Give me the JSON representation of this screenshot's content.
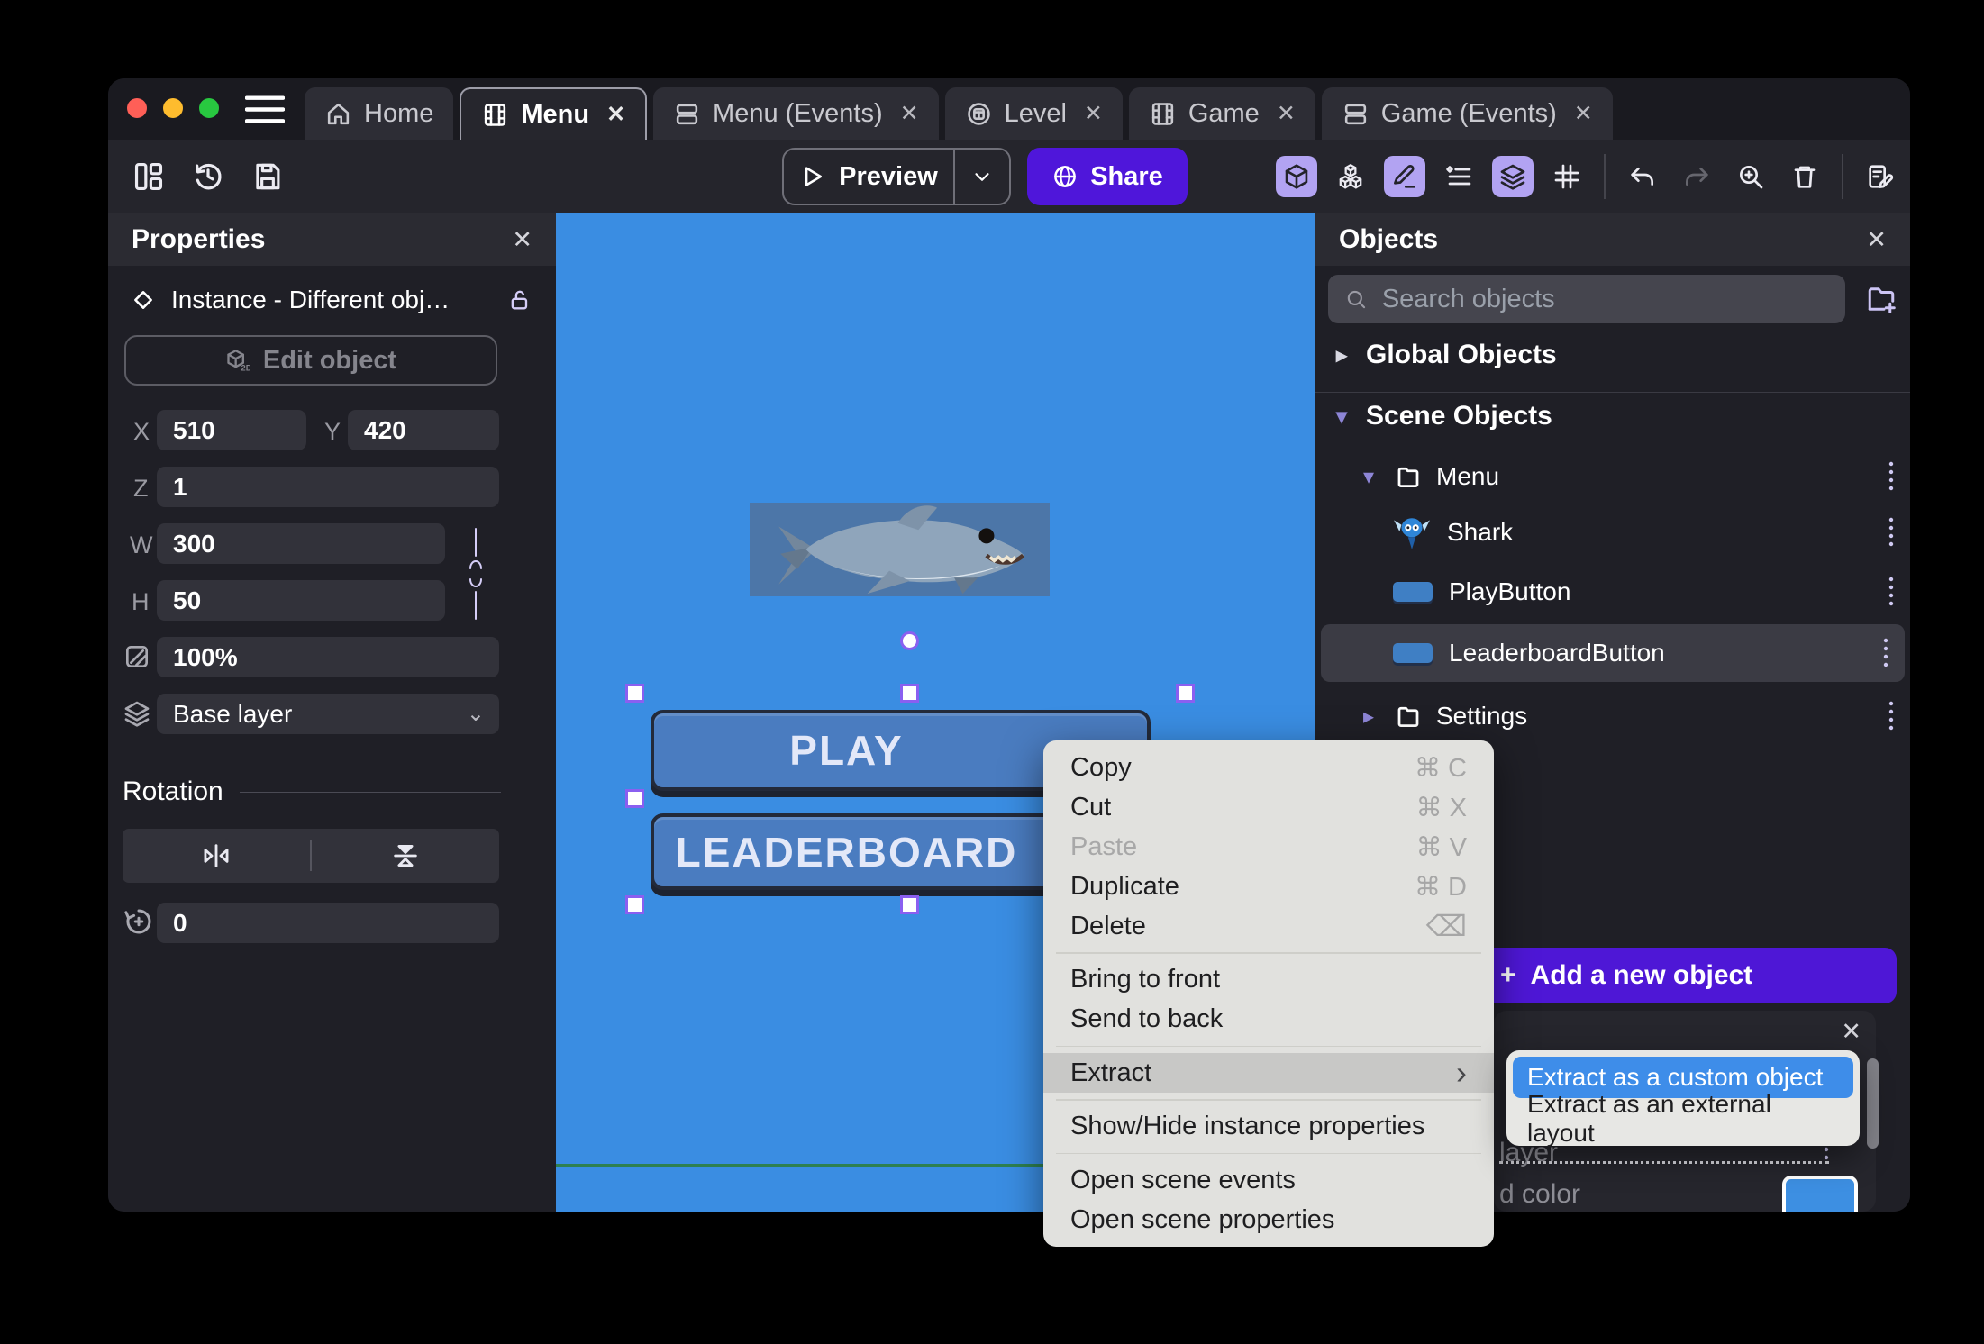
{
  "titlebar": {
    "close_glyph": "✕",
    "traffic_lights": {
      "close": "#ff5f57",
      "minimize": "#febc2e",
      "zoom": "#28c840"
    },
    "tabs": [
      {
        "label": "Home",
        "icon": "home",
        "active": false
      },
      {
        "label": "Menu",
        "icon": "film",
        "active": true
      },
      {
        "label": "Menu (Events)",
        "icon": "events",
        "active": false
      },
      {
        "label": "Level",
        "icon": "level",
        "active": false
      },
      {
        "label": "Game",
        "icon": "film",
        "active": false
      },
      {
        "label": "Game (Events)",
        "icon": "events",
        "active": false
      }
    ]
  },
  "toolbar": {
    "preview_label": "Preview",
    "share_label": "Share"
  },
  "properties_panel": {
    "title": "Properties",
    "close_glyph": "✕",
    "instance_text": "Instance  -  Different obj…",
    "edit_object_label": "Edit object",
    "rotation_heading": "Rotation",
    "fields": {
      "x_label": "X",
      "x_value": "510",
      "y_label": "Y",
      "y_value": "420",
      "z_label": "Z",
      "z_value": "1",
      "w_label": "W",
      "w_value": "300",
      "h_label": "H",
      "h_value": "50",
      "opacity_value": "100%",
      "layer_value": "Base layer",
      "layer_caret": "⌄",
      "rotation_value": "0"
    }
  },
  "canvas": {
    "background_color": "#3a8de2",
    "play_button_label": "PLAY",
    "leaderboard_button_label": "LEADERBOARD"
  },
  "objects_panel": {
    "title": "Objects",
    "close_glyph": "✕",
    "search_placeholder": "Search objects",
    "global_objects_label": "Global Objects",
    "scene_objects_label": "Scene Objects",
    "tree": [
      {
        "label": "Menu",
        "type": "folder",
        "state": "expanded"
      },
      {
        "label": "Shark",
        "type": "sprite"
      },
      {
        "label": "PlayButton",
        "type": "button"
      },
      {
        "label": "LeaderboardButton",
        "type": "button",
        "selected": true
      },
      {
        "label": "Settings",
        "type": "folder",
        "state": "collapsed"
      }
    ],
    "add_object_plus": "+",
    "add_object_label": "Add a new object"
  },
  "instance_panel": {
    "close_glyph": "✕",
    "layer_text": "layer",
    "color_text": "d color",
    "swatch_color": "#3d8fe2"
  },
  "context_menu": {
    "items": [
      {
        "label": "Copy",
        "shortcut": "⌘ C"
      },
      {
        "label": "Cut",
        "shortcut": "⌘ X"
      },
      {
        "label": "Paste",
        "shortcut": "⌘ V",
        "disabled": true
      },
      {
        "label": "Duplicate",
        "shortcut": "⌘ D"
      },
      {
        "label": "Delete",
        "shortcut": "⌫"
      },
      {
        "label": "Bring to front"
      },
      {
        "label": "Send to back"
      },
      {
        "label": "Extract",
        "highlighted": true,
        "arrow": "›"
      },
      {
        "label": "Show/Hide instance properties"
      },
      {
        "label": "Open scene events"
      },
      {
        "label": "Open scene properties"
      }
    ]
  },
  "submenu": {
    "items": [
      {
        "label": "Extract as a custom object",
        "highlighted": true
      },
      {
        "label": "Extract as an external layout"
      }
    ]
  }
}
